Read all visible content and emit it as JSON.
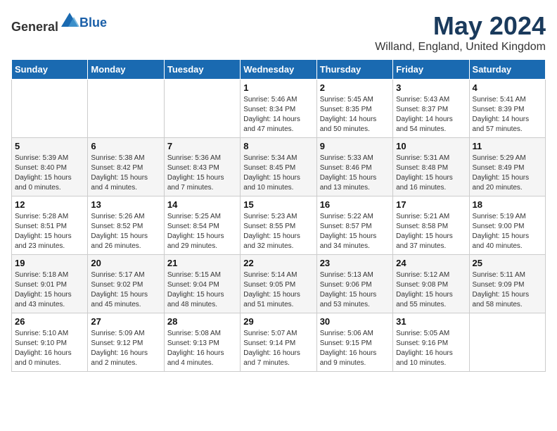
{
  "header": {
    "logo_general": "General",
    "logo_blue": "Blue",
    "month_title": "May 2024",
    "location": "Willand, England, United Kingdom"
  },
  "weekdays": [
    "Sunday",
    "Monday",
    "Tuesday",
    "Wednesday",
    "Thursday",
    "Friday",
    "Saturday"
  ],
  "weeks": [
    [
      {
        "day": "",
        "info": ""
      },
      {
        "day": "",
        "info": ""
      },
      {
        "day": "",
        "info": ""
      },
      {
        "day": "1",
        "info": "Sunrise: 5:46 AM\nSunset: 8:34 PM\nDaylight: 14 hours\nand 47 minutes."
      },
      {
        "day": "2",
        "info": "Sunrise: 5:45 AM\nSunset: 8:35 PM\nDaylight: 14 hours\nand 50 minutes."
      },
      {
        "day": "3",
        "info": "Sunrise: 5:43 AM\nSunset: 8:37 PM\nDaylight: 14 hours\nand 54 minutes."
      },
      {
        "day": "4",
        "info": "Sunrise: 5:41 AM\nSunset: 8:39 PM\nDaylight: 14 hours\nand 57 minutes."
      }
    ],
    [
      {
        "day": "5",
        "info": "Sunrise: 5:39 AM\nSunset: 8:40 PM\nDaylight: 15 hours\nand 0 minutes."
      },
      {
        "day": "6",
        "info": "Sunrise: 5:38 AM\nSunset: 8:42 PM\nDaylight: 15 hours\nand 4 minutes."
      },
      {
        "day": "7",
        "info": "Sunrise: 5:36 AM\nSunset: 8:43 PM\nDaylight: 15 hours\nand 7 minutes."
      },
      {
        "day": "8",
        "info": "Sunrise: 5:34 AM\nSunset: 8:45 PM\nDaylight: 15 hours\nand 10 minutes."
      },
      {
        "day": "9",
        "info": "Sunrise: 5:33 AM\nSunset: 8:46 PM\nDaylight: 15 hours\nand 13 minutes."
      },
      {
        "day": "10",
        "info": "Sunrise: 5:31 AM\nSunset: 8:48 PM\nDaylight: 15 hours\nand 16 minutes."
      },
      {
        "day": "11",
        "info": "Sunrise: 5:29 AM\nSunset: 8:49 PM\nDaylight: 15 hours\nand 20 minutes."
      }
    ],
    [
      {
        "day": "12",
        "info": "Sunrise: 5:28 AM\nSunset: 8:51 PM\nDaylight: 15 hours\nand 23 minutes."
      },
      {
        "day": "13",
        "info": "Sunrise: 5:26 AM\nSunset: 8:52 PM\nDaylight: 15 hours\nand 26 minutes."
      },
      {
        "day": "14",
        "info": "Sunrise: 5:25 AM\nSunset: 8:54 PM\nDaylight: 15 hours\nand 29 minutes."
      },
      {
        "day": "15",
        "info": "Sunrise: 5:23 AM\nSunset: 8:55 PM\nDaylight: 15 hours\nand 32 minutes."
      },
      {
        "day": "16",
        "info": "Sunrise: 5:22 AM\nSunset: 8:57 PM\nDaylight: 15 hours\nand 34 minutes."
      },
      {
        "day": "17",
        "info": "Sunrise: 5:21 AM\nSunset: 8:58 PM\nDaylight: 15 hours\nand 37 minutes."
      },
      {
        "day": "18",
        "info": "Sunrise: 5:19 AM\nSunset: 9:00 PM\nDaylight: 15 hours\nand 40 minutes."
      }
    ],
    [
      {
        "day": "19",
        "info": "Sunrise: 5:18 AM\nSunset: 9:01 PM\nDaylight: 15 hours\nand 43 minutes."
      },
      {
        "day": "20",
        "info": "Sunrise: 5:17 AM\nSunset: 9:02 PM\nDaylight: 15 hours\nand 45 minutes."
      },
      {
        "day": "21",
        "info": "Sunrise: 5:15 AM\nSunset: 9:04 PM\nDaylight: 15 hours\nand 48 minutes."
      },
      {
        "day": "22",
        "info": "Sunrise: 5:14 AM\nSunset: 9:05 PM\nDaylight: 15 hours\nand 51 minutes."
      },
      {
        "day": "23",
        "info": "Sunrise: 5:13 AM\nSunset: 9:06 PM\nDaylight: 15 hours\nand 53 minutes."
      },
      {
        "day": "24",
        "info": "Sunrise: 5:12 AM\nSunset: 9:08 PM\nDaylight: 15 hours\nand 55 minutes."
      },
      {
        "day": "25",
        "info": "Sunrise: 5:11 AM\nSunset: 9:09 PM\nDaylight: 15 hours\nand 58 minutes."
      }
    ],
    [
      {
        "day": "26",
        "info": "Sunrise: 5:10 AM\nSunset: 9:10 PM\nDaylight: 16 hours\nand 0 minutes."
      },
      {
        "day": "27",
        "info": "Sunrise: 5:09 AM\nSunset: 9:12 PM\nDaylight: 16 hours\nand 2 minutes."
      },
      {
        "day": "28",
        "info": "Sunrise: 5:08 AM\nSunset: 9:13 PM\nDaylight: 16 hours\nand 4 minutes."
      },
      {
        "day": "29",
        "info": "Sunrise: 5:07 AM\nSunset: 9:14 PM\nDaylight: 16 hours\nand 7 minutes."
      },
      {
        "day": "30",
        "info": "Sunrise: 5:06 AM\nSunset: 9:15 PM\nDaylight: 16 hours\nand 9 minutes."
      },
      {
        "day": "31",
        "info": "Sunrise: 5:05 AM\nSunset: 9:16 PM\nDaylight: 16 hours\nand 10 minutes."
      },
      {
        "day": "",
        "info": ""
      }
    ]
  ]
}
